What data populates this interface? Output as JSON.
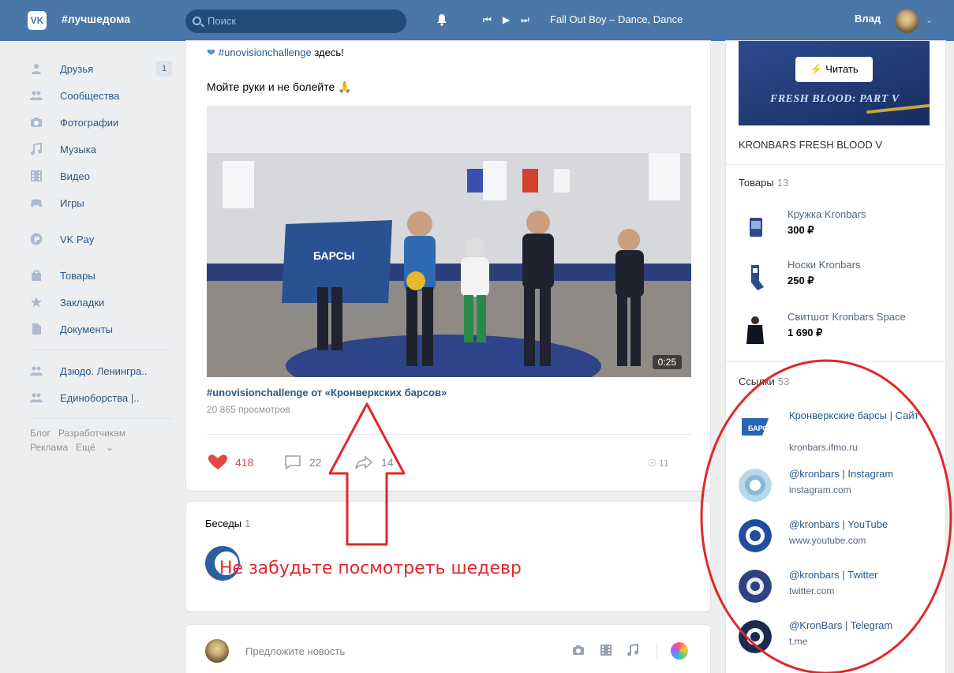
{
  "header": {
    "logo": "VK",
    "brand": "#лучшедома",
    "search_placeholder": "Поиск",
    "track": "Fall Out Boy – Dance, Dance",
    "user_name": "Влад"
  },
  "nav": {
    "items": [
      {
        "label": "Друзья",
        "icon": "friends-icon",
        "badge": "1"
      },
      {
        "label": "Сообщества",
        "icon": "communities-icon"
      },
      {
        "label": "Фотографии",
        "icon": "camera-icon"
      },
      {
        "label": "Музыка",
        "icon": "music-icon"
      },
      {
        "label": "Видео",
        "icon": "video-icon"
      },
      {
        "label": "Игры",
        "icon": "games-icon"
      }
    ],
    "pay": {
      "label": "VK Pay",
      "icon": "vkpay-icon"
    },
    "items2": [
      {
        "label": "Товары",
        "icon": "bag-icon"
      },
      {
        "label": "Закладки",
        "icon": "star-icon"
      },
      {
        "label": "Документы",
        "icon": "document-icon"
      }
    ],
    "groups": [
      {
        "label": "Дзюдо. Ленингра..",
        "icon": "group-icon"
      },
      {
        "label": "Единоборства |..",
        "icon": "group-icon"
      }
    ],
    "footer": {
      "blog": "Блог",
      "dev": "Разработчикам",
      "ads": "Реклама",
      "more": "Ещё"
    }
  },
  "post": {
    "hashtag": "#unovisionchallenge",
    "hashtag_suffix": "здесь!",
    "text": "Мойте руки и не болейте",
    "video_duration": "0:25",
    "video_title": "#unovisionchallenge от «Кронверкских барсов»",
    "views": "20 865 просмотров",
    "likes": "418",
    "comments": "22",
    "shares": "14",
    "view_count": "11"
  },
  "chats": {
    "title": "Беседы",
    "count": "1"
  },
  "suggest": {
    "placeholder": "Предложите новость"
  },
  "right": {
    "read_button": "Читать",
    "banner_text": "FRESH BLOOD: PART V",
    "banner_title": "KRONBARS FRESH BLOOD V",
    "goods_title": "Товары",
    "goods_count": "13",
    "goods": [
      {
        "name": "Кружка Kronbars",
        "price": "300 ₽"
      },
      {
        "name": "Носки Kronbars",
        "price": "250 ₽"
      },
      {
        "name": "Свитшот Kronbars Space",
        "price": "1 690 ₽"
      }
    ],
    "links_title": "Ссылки",
    "links_count": "53",
    "links": [
      {
        "name": "Кронверкские барсы | Сайт",
        "url": "kronbars.ifmo.ru"
      },
      {
        "name": "@kronbars | Instagram",
        "url": "instagram.com"
      },
      {
        "name": "@kronbars | YouTube",
        "url": "www.youtube.com"
      },
      {
        "name": "@kronbars | Twitter",
        "url": "twitter.com"
      },
      {
        "name": "@KronBars | Telegram",
        "url": "t.me"
      }
    ]
  },
  "annotation": {
    "text": "Не забудьте посмотреть шедевр"
  },
  "colors": {
    "header": "#4a76a8",
    "link": "#2a5885",
    "like": "#e64646",
    "annotation": "#e02828"
  }
}
